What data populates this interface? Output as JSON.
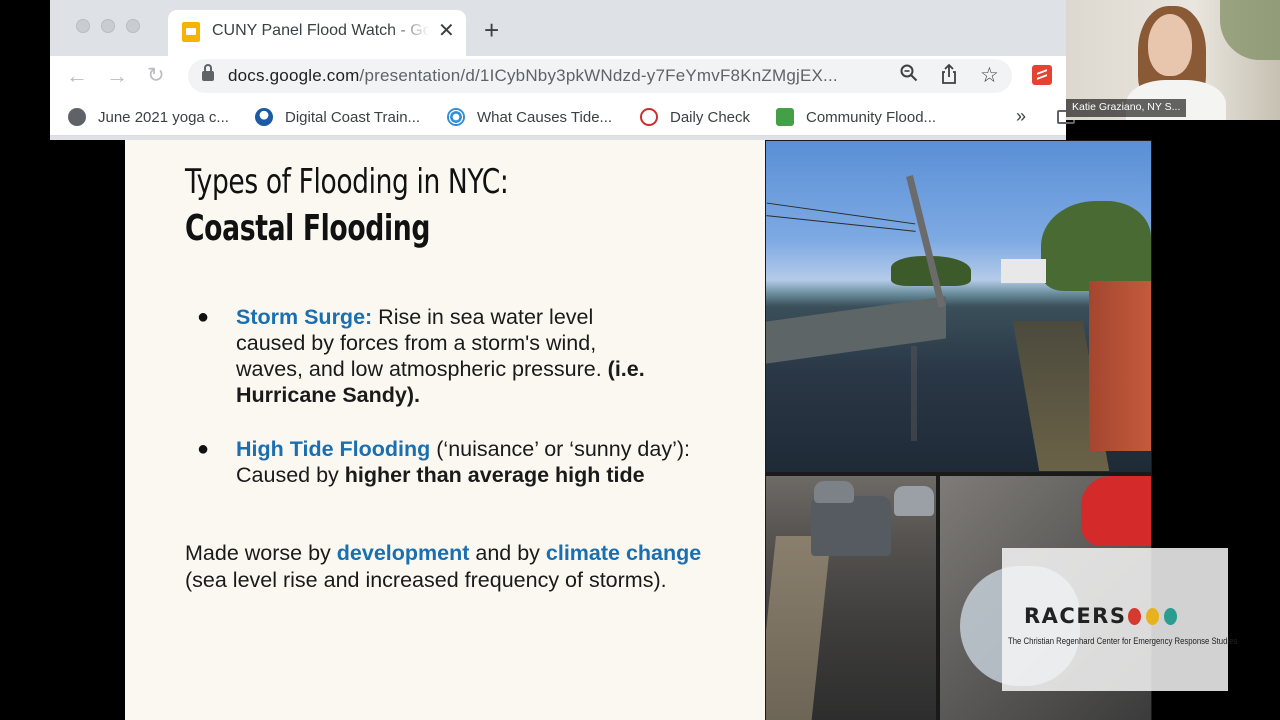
{
  "browser": {
    "tab_title": "CUNY Panel Flood Watch - Google Slides",
    "new_tab_icon": "plus-icon",
    "url_domain": "docs.google.com",
    "url_path": "/presentation/d/1ICybNby3pkWNdzd-y7FeYmvF8KnZMgjEX...",
    "bookmarks": [
      {
        "label": "June 2021 yoga c...",
        "icon": "globe-icon",
        "color": "#3c4043"
      },
      {
        "label": "Digital Coast Train...",
        "icon": "noaa-icon",
        "color": "#1a5aa6"
      },
      {
        "label": "What Causes Tide...",
        "icon": "spiral-icon",
        "color": "#2f8fd8"
      },
      {
        "label": "Daily Check",
        "icon": "daily-check-icon",
        "color": "#c9302c"
      },
      {
        "label": "Community Flood...",
        "icon": "community-flood-icon",
        "color": "#43a047"
      }
    ]
  },
  "slide": {
    "title_line1": "Types of Flooding in NYC:",
    "title_line2": "Coastal Flooding",
    "bullet1": {
      "term": "Storm Surge:",
      "text": " Rise in sea water level caused by forces from a storm's wind, waves, and low atmospheric pressure. ",
      "bold": "(i.e. Hurricane Sandy)."
    },
    "bullet2": {
      "term": "High Tide Flooding",
      "text": " (‘nuisance’ or ‘sunny day’): Caused by ",
      "bold": "higher than average high tide"
    },
    "paragraph": {
      "pre": "Made worse by ",
      "hl1": "development",
      "mid": " and by ",
      "hl2": "climate change",
      "post": " (sea level rise and increased frequency of storms)."
    },
    "accent_color": "#1a6fb0"
  },
  "webcam": {
    "name": "Katie Graziano, NY S..."
  },
  "logo": {
    "word": "RACERS",
    "subtitle": "The Christian Regenhard Center for Emergency Response Studies",
    "dot_colors": [
      "#d63a2f",
      "#e8b21e",
      "#2a9d8f"
    ]
  }
}
